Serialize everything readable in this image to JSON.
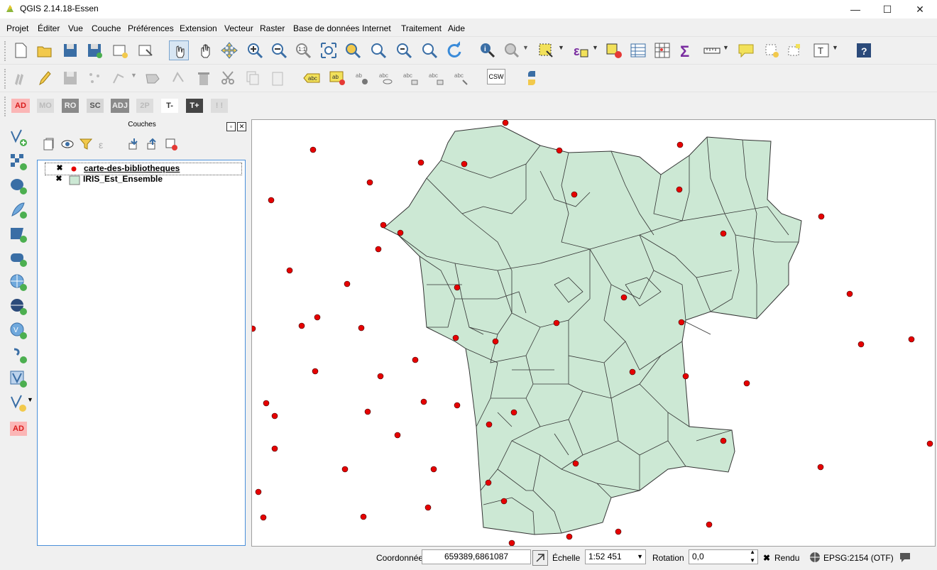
{
  "window": {
    "title": "QGIS 2.14.18-Essen",
    "minimize": "—",
    "maximize": "☐",
    "close": "✕"
  },
  "menu": [
    "Projet",
    "Éditer",
    "Vue",
    "Couche",
    "Préférences",
    "Extension",
    "Vecteur",
    "Raster",
    "Base de données",
    "Internet",
    "Traitement",
    "Aide"
  ],
  "toolbar3": [
    "AD",
    "MO",
    "RO",
    "SC",
    "ADJ",
    "2P",
    "T-",
    "T+",
    "! !"
  ],
  "toolbar2_csw": "CSW",
  "leftbar_ad": "AD",
  "layers_panel": {
    "title": "Couches",
    "layers": [
      {
        "name": "carte-des-bibliotheques",
        "checked": "✖",
        "symbol": "point",
        "color": "#e60000"
      },
      {
        "name": "IRIS_Est_Ensemble",
        "checked": "✖",
        "symbol": "polygon",
        "color": "#cce8d4"
      }
    ]
  },
  "map": {
    "fill": "#cce8d4",
    "stroke": "#333333",
    "point_color": "#e60000"
  },
  "status": {
    "coord_label": "Coordonnée",
    "coord_value": "659389,6861087",
    "scale_label": "Échelle",
    "scale_value": "1:52 451",
    "rotation_label": "Rotation",
    "rotation_value": "0,0",
    "render_check": "✖",
    "render_label": "Rendu",
    "crs": "EPSG:2154 (OTF)"
  }
}
